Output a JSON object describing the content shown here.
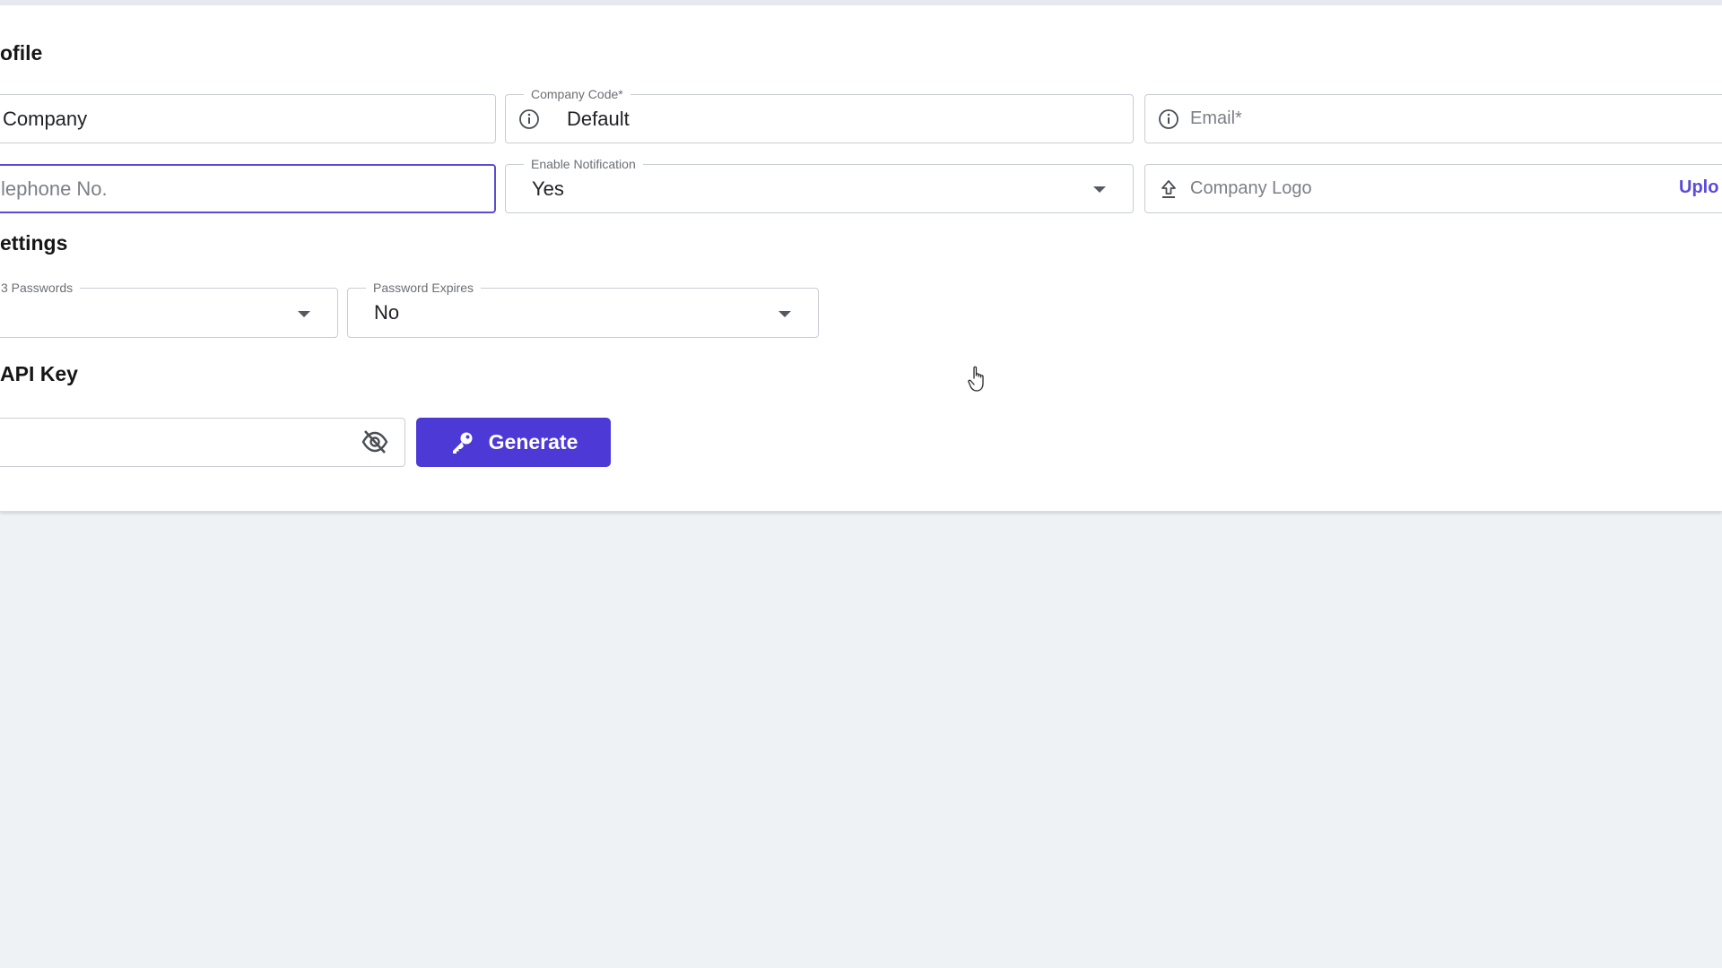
{
  "company_profile": {
    "title": "ofile",
    "company_name": {
      "value": "Company"
    },
    "company_code": {
      "label": "Company Code*",
      "value": "Default",
      "icon": "info-icon"
    },
    "email": {
      "placeholder": "Email*",
      "icon": "info-icon"
    },
    "telephone": {
      "placeholder": "lephone No."
    },
    "enable_notification": {
      "label": "Enable Notification",
      "value": "Yes"
    },
    "company_logo": {
      "placeholder": "Company Logo",
      "action": "Uplo",
      "icon": "upload-icon"
    }
  },
  "security_settings": {
    "title": "ettings",
    "last_passwords": {
      "label": "3 Passwords",
      "value": ""
    },
    "password_expires": {
      "label": "Password Expires",
      "value": "No"
    }
  },
  "api_key": {
    "title": "API Key",
    "value": "",
    "visibility_icon": "eye-off-icon",
    "generate_label": "Generate",
    "generate_icon": "key-icon"
  },
  "colors": {
    "accent": "#4d3ad6",
    "focus_border": "#5b4bd8",
    "page_background": "#eef2f5"
  }
}
